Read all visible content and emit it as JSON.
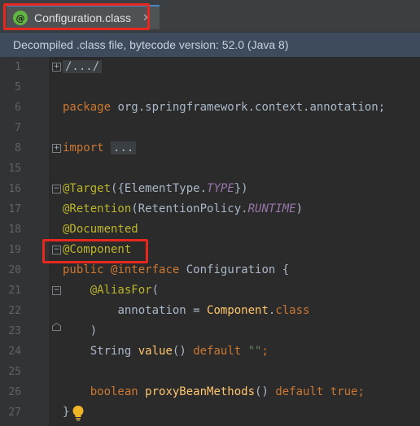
{
  "tab": {
    "icon_glyph": "@",
    "title": "Configuration.class",
    "close_glyph": "✕"
  },
  "banner": {
    "text": "Decompiled .class file, bytecode version: 52.0 (Java 8)"
  },
  "editor": {
    "line_numbers": [
      "1",
      "5",
      "6",
      "7",
      "8",
      "15",
      "16",
      "17",
      "18",
      "19",
      "20",
      "21",
      "22",
      "23",
      "24",
      "25",
      "26",
      "27"
    ],
    "lines": {
      "l1_fold": "/.../",
      "l6_package_kw": "package",
      "l6_package_name": " org.springframework.context.annotation;",
      "l8_import_kw": "import",
      "l8_import_fold": "...",
      "l16_ann": "@Target",
      "l16_rest1": "({ElementType.",
      "l16_const": "TYPE",
      "l16_rest2": "})",
      "l17_ann": "@Retention",
      "l17_rest1": "(RetentionPolicy.",
      "l17_const": "RUNTIME",
      "l17_rest2": ")",
      "l18_ann": "@Documented",
      "l19_ann": "@Component",
      "l20_kw1": "public",
      "l20_kw2": "@interface",
      "l20_name": "Configuration",
      "l20_brace": " {",
      "l21_indent": "    ",
      "l21_ann": "@AliasFor",
      "l21_paren": "(",
      "l22_indent": "        ",
      "l22_attr": "annotation",
      "l22_eq": " = ",
      "l22_ref": "Component",
      "l22_dot": ".",
      "l22_kw": "class",
      "l23_text": "    )",
      "l24_indent": "    ",
      "l24_type": "String ",
      "l24_method": "value",
      "l24_parens": "() ",
      "l24_kw": "default",
      "l24_str": " \"\"",
      "l24_semi": ";",
      "l26_indent": "    ",
      "l26_kw": "boolean",
      "l26_method": " proxyBeanMethods",
      "l26_parens": "() ",
      "l26_kw2": "default",
      "l26_val": " true",
      "l26_semi": ";",
      "l27_brace": "}"
    }
  },
  "colors": {
    "keyword": "#cc7832",
    "annotation": "#bbb529",
    "constant": "#9876aa",
    "method": "#ffc66d",
    "string": "#6a8759",
    "highlight": "#e8271f"
  }
}
